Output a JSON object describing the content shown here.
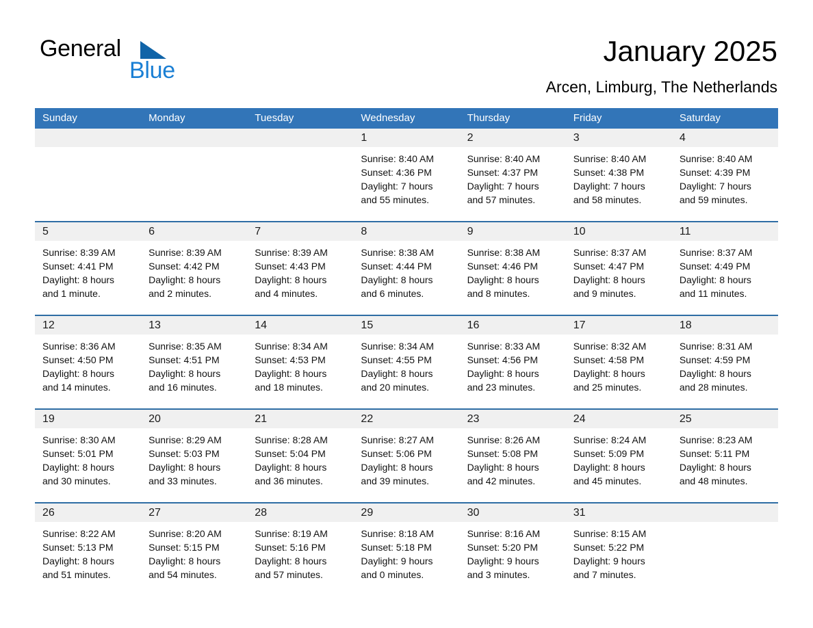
{
  "logo": {
    "word1": "General",
    "word2": "Blue",
    "triangle_color": "#1064a8",
    "word2_color": "#1a7fd4"
  },
  "header": {
    "title": "January 2025",
    "location": "Arcen, Limburg, The Netherlands"
  },
  "colors": {
    "header_blue": "#3275b8",
    "separator_blue": "#2e6da4",
    "daynum_band": "#f0f0f0"
  },
  "weekday_headers": [
    "Sunday",
    "Monday",
    "Tuesday",
    "Wednesday",
    "Thursday",
    "Friday",
    "Saturday"
  ],
  "weeks": [
    {
      "days": [
        {
          "num": "",
          "lines": []
        },
        {
          "num": "",
          "lines": []
        },
        {
          "num": "",
          "lines": []
        },
        {
          "num": "1",
          "lines": [
            "Sunrise: 8:40 AM",
            "Sunset: 4:36 PM",
            "Daylight: 7 hours",
            "and 55 minutes."
          ]
        },
        {
          "num": "2",
          "lines": [
            "Sunrise: 8:40 AM",
            "Sunset: 4:37 PM",
            "Daylight: 7 hours",
            "and 57 minutes."
          ]
        },
        {
          "num": "3",
          "lines": [
            "Sunrise: 8:40 AM",
            "Sunset: 4:38 PM",
            "Daylight: 7 hours",
            "and 58 minutes."
          ]
        },
        {
          "num": "4",
          "lines": [
            "Sunrise: 8:40 AM",
            "Sunset: 4:39 PM",
            "Daylight: 7 hours",
            "and 59 minutes."
          ]
        }
      ]
    },
    {
      "days": [
        {
          "num": "5",
          "lines": [
            "Sunrise: 8:39 AM",
            "Sunset: 4:41 PM",
            "Daylight: 8 hours",
            "and 1 minute."
          ]
        },
        {
          "num": "6",
          "lines": [
            "Sunrise: 8:39 AM",
            "Sunset: 4:42 PM",
            "Daylight: 8 hours",
            "and 2 minutes."
          ]
        },
        {
          "num": "7",
          "lines": [
            "Sunrise: 8:39 AM",
            "Sunset: 4:43 PM",
            "Daylight: 8 hours",
            "and 4 minutes."
          ]
        },
        {
          "num": "8",
          "lines": [
            "Sunrise: 8:38 AM",
            "Sunset: 4:44 PM",
            "Daylight: 8 hours",
            "and 6 minutes."
          ]
        },
        {
          "num": "9",
          "lines": [
            "Sunrise: 8:38 AM",
            "Sunset: 4:46 PM",
            "Daylight: 8 hours",
            "and 8 minutes."
          ]
        },
        {
          "num": "10",
          "lines": [
            "Sunrise: 8:37 AM",
            "Sunset: 4:47 PM",
            "Daylight: 8 hours",
            "and 9 minutes."
          ]
        },
        {
          "num": "11",
          "lines": [
            "Sunrise: 8:37 AM",
            "Sunset: 4:49 PM",
            "Daylight: 8 hours",
            "and 11 minutes."
          ]
        }
      ]
    },
    {
      "days": [
        {
          "num": "12",
          "lines": [
            "Sunrise: 8:36 AM",
            "Sunset: 4:50 PM",
            "Daylight: 8 hours",
            "and 14 minutes."
          ]
        },
        {
          "num": "13",
          "lines": [
            "Sunrise: 8:35 AM",
            "Sunset: 4:51 PM",
            "Daylight: 8 hours",
            "and 16 minutes."
          ]
        },
        {
          "num": "14",
          "lines": [
            "Sunrise: 8:34 AM",
            "Sunset: 4:53 PM",
            "Daylight: 8 hours",
            "and 18 minutes."
          ]
        },
        {
          "num": "15",
          "lines": [
            "Sunrise: 8:34 AM",
            "Sunset: 4:55 PM",
            "Daylight: 8 hours",
            "and 20 minutes."
          ]
        },
        {
          "num": "16",
          "lines": [
            "Sunrise: 8:33 AM",
            "Sunset: 4:56 PM",
            "Daylight: 8 hours",
            "and 23 minutes."
          ]
        },
        {
          "num": "17",
          "lines": [
            "Sunrise: 8:32 AM",
            "Sunset: 4:58 PM",
            "Daylight: 8 hours",
            "and 25 minutes."
          ]
        },
        {
          "num": "18",
          "lines": [
            "Sunrise: 8:31 AM",
            "Sunset: 4:59 PM",
            "Daylight: 8 hours",
            "and 28 minutes."
          ]
        }
      ]
    },
    {
      "days": [
        {
          "num": "19",
          "lines": [
            "Sunrise: 8:30 AM",
            "Sunset: 5:01 PM",
            "Daylight: 8 hours",
            "and 30 minutes."
          ]
        },
        {
          "num": "20",
          "lines": [
            "Sunrise: 8:29 AM",
            "Sunset: 5:03 PM",
            "Daylight: 8 hours",
            "and 33 minutes."
          ]
        },
        {
          "num": "21",
          "lines": [
            "Sunrise: 8:28 AM",
            "Sunset: 5:04 PM",
            "Daylight: 8 hours",
            "and 36 minutes."
          ]
        },
        {
          "num": "22",
          "lines": [
            "Sunrise: 8:27 AM",
            "Sunset: 5:06 PM",
            "Daylight: 8 hours",
            "and 39 minutes."
          ]
        },
        {
          "num": "23",
          "lines": [
            "Sunrise: 8:26 AM",
            "Sunset: 5:08 PM",
            "Daylight: 8 hours",
            "and 42 minutes."
          ]
        },
        {
          "num": "24",
          "lines": [
            "Sunrise: 8:24 AM",
            "Sunset: 5:09 PM",
            "Daylight: 8 hours",
            "and 45 minutes."
          ]
        },
        {
          "num": "25",
          "lines": [
            "Sunrise: 8:23 AM",
            "Sunset: 5:11 PM",
            "Daylight: 8 hours",
            "and 48 minutes."
          ]
        }
      ]
    },
    {
      "days": [
        {
          "num": "26",
          "lines": [
            "Sunrise: 8:22 AM",
            "Sunset: 5:13 PM",
            "Daylight: 8 hours",
            "and 51 minutes."
          ]
        },
        {
          "num": "27",
          "lines": [
            "Sunrise: 8:20 AM",
            "Sunset: 5:15 PM",
            "Daylight: 8 hours",
            "and 54 minutes."
          ]
        },
        {
          "num": "28",
          "lines": [
            "Sunrise: 8:19 AM",
            "Sunset: 5:16 PM",
            "Daylight: 8 hours",
            "and 57 minutes."
          ]
        },
        {
          "num": "29",
          "lines": [
            "Sunrise: 8:18 AM",
            "Sunset: 5:18 PM",
            "Daylight: 9 hours",
            "and 0 minutes."
          ]
        },
        {
          "num": "30",
          "lines": [
            "Sunrise: 8:16 AM",
            "Sunset: 5:20 PM",
            "Daylight: 9 hours",
            "and 3 minutes."
          ]
        },
        {
          "num": "31",
          "lines": [
            "Sunrise: 8:15 AM",
            "Sunset: 5:22 PM",
            "Daylight: 9 hours",
            "and 7 minutes."
          ]
        },
        {
          "num": "",
          "lines": []
        }
      ]
    }
  ]
}
